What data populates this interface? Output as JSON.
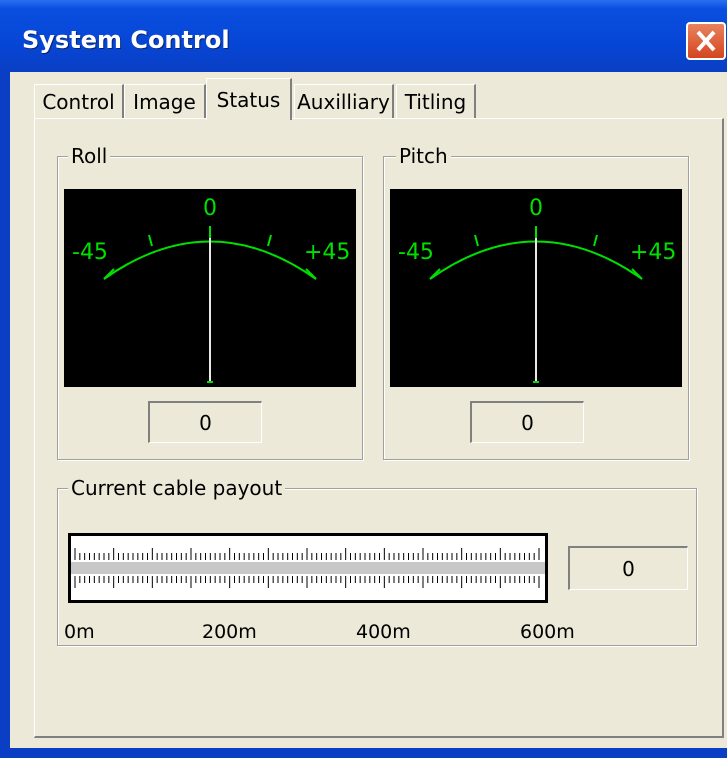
{
  "window": {
    "title": "System Control"
  },
  "tabs": [
    {
      "label": "Control"
    },
    {
      "label": "Image"
    },
    {
      "label": "Status"
    },
    {
      "label": "Auxilliary"
    },
    {
      "label": "Titling"
    }
  ],
  "active_tab": "Status",
  "roll": {
    "label": "Roll",
    "scale_left": "-45",
    "scale_center": "0",
    "scale_right": "+45",
    "value": "0"
  },
  "pitch": {
    "label": "Pitch",
    "scale_left": "-45",
    "scale_center": "0",
    "scale_right": "+45",
    "value": "0"
  },
  "cable": {
    "label": "Current cable payout",
    "value": "0",
    "ticks": [
      "0m",
      "200m",
      "400m",
      "600m"
    ],
    "fill": 0
  },
  "colors": {
    "gauge_green": "#00e000",
    "titlebar": "#0646d6",
    "face": "#ece9d8"
  }
}
